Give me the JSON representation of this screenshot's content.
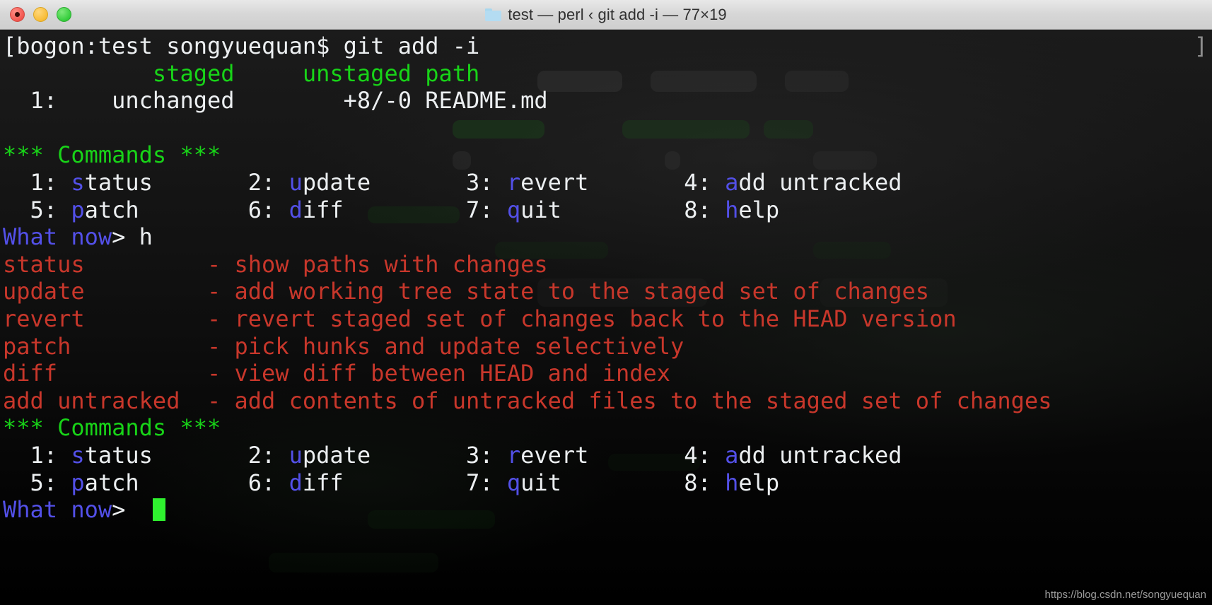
{
  "window": {
    "title": "test — perl ‹ git add -i — 77×19",
    "folder_icon": "folder-icon",
    "buttons": {
      "close": "close-button",
      "minimize": "minimize-button",
      "maximize": "maximize-button"
    }
  },
  "colors": {
    "background": "#0d0d0d",
    "foreground": "#eceff1",
    "green": "#18d318",
    "blue": "#5350e8",
    "red": "#c8372b",
    "cursor": "#2ff22f",
    "titlebar": "#d6d6d6"
  },
  "terminal": {
    "size": "77×19",
    "prompt_bracket_right": "]",
    "lines": [
      {
        "name": "shell-prompt-line",
        "segments": [
          {
            "text": "[bogon:test songyuequan$ git add -i",
            "color": "white"
          }
        ]
      },
      {
        "name": "status-header-line",
        "segments": [
          {
            "text": "           ",
            "color": "white"
          },
          {
            "text": "staged",
            "color": "green"
          },
          {
            "text": "     ",
            "color": "white"
          },
          {
            "text": "unstaged path",
            "color": "green"
          }
        ]
      },
      {
        "name": "status-row-readme",
        "segments": [
          {
            "text": "  1:    unchanged        +8/-0 README.md",
            "color": "white"
          }
        ]
      },
      {
        "name": "blank-line-1",
        "segments": [
          {
            "text": " ",
            "color": "white"
          }
        ]
      },
      {
        "name": "commands-heading-1",
        "segments": [
          {
            "text": "*** Commands ***",
            "color": "green"
          }
        ]
      },
      {
        "name": "commands-row-1a",
        "segments": [
          {
            "text": "  1: ",
            "color": "white"
          },
          {
            "text": "s",
            "color": "blue"
          },
          {
            "text": "tatus       ",
            "color": "white"
          },
          {
            "text": "2: ",
            "color": "white"
          },
          {
            "text": "u",
            "color": "blue"
          },
          {
            "text": "pdate       ",
            "color": "white"
          },
          {
            "text": "3: ",
            "color": "white"
          },
          {
            "text": "r",
            "color": "blue"
          },
          {
            "text": "evert       ",
            "color": "white"
          },
          {
            "text": "4: ",
            "color": "white"
          },
          {
            "text": "a",
            "color": "blue"
          },
          {
            "text": "dd untracked",
            "color": "white"
          }
        ]
      },
      {
        "name": "commands-row-1b",
        "segments": [
          {
            "text": "  5: ",
            "color": "white"
          },
          {
            "text": "p",
            "color": "blue"
          },
          {
            "text": "atch        ",
            "color": "white"
          },
          {
            "text": "6: ",
            "color": "white"
          },
          {
            "text": "d",
            "color": "blue"
          },
          {
            "text": "iff         ",
            "color": "white"
          },
          {
            "text": "7: ",
            "color": "white"
          },
          {
            "text": "q",
            "color": "blue"
          },
          {
            "text": "uit         ",
            "color": "white"
          },
          {
            "text": "8: ",
            "color": "white"
          },
          {
            "text": "h",
            "color": "blue"
          },
          {
            "text": "elp",
            "color": "white"
          }
        ]
      },
      {
        "name": "what-now-prompt-1",
        "segments": [
          {
            "text": "What now",
            "color": "blue"
          },
          {
            "text": "> h",
            "color": "white"
          }
        ]
      },
      {
        "name": "help-line-status",
        "segments": [
          {
            "text": "status         - show paths with changes",
            "color": "red"
          }
        ]
      },
      {
        "name": "help-line-update",
        "segments": [
          {
            "text": "update         - add working tree state to the staged set of changes",
            "color": "red"
          }
        ]
      },
      {
        "name": "help-line-revert",
        "segments": [
          {
            "text": "revert         - revert staged set of changes back to the HEAD version",
            "color": "red"
          }
        ]
      },
      {
        "name": "help-line-patch",
        "segments": [
          {
            "text": "patch          - pick hunks and update selectively",
            "color": "red"
          }
        ]
      },
      {
        "name": "help-line-diff",
        "segments": [
          {
            "text": "diff           - view diff between HEAD and index",
            "color": "red"
          }
        ]
      },
      {
        "name": "help-line-add-untracked",
        "segments": [
          {
            "text": "add untracked  - add contents of untracked files to the staged set of changes",
            "color": "red"
          }
        ]
      },
      {
        "name": "commands-heading-2",
        "segments": [
          {
            "text": "*** Commands ***",
            "color": "green"
          }
        ]
      },
      {
        "name": "commands-row-2a",
        "segments": [
          {
            "text": "  1: ",
            "color": "white"
          },
          {
            "text": "s",
            "color": "blue"
          },
          {
            "text": "tatus       ",
            "color": "white"
          },
          {
            "text": "2: ",
            "color": "white"
          },
          {
            "text": "u",
            "color": "blue"
          },
          {
            "text": "pdate       ",
            "color": "white"
          },
          {
            "text": "3: ",
            "color": "white"
          },
          {
            "text": "r",
            "color": "blue"
          },
          {
            "text": "evert       ",
            "color": "white"
          },
          {
            "text": "4: ",
            "color": "white"
          },
          {
            "text": "a",
            "color": "blue"
          },
          {
            "text": "dd untracked",
            "color": "white"
          }
        ]
      },
      {
        "name": "commands-row-2b",
        "segments": [
          {
            "text": "  5: ",
            "color": "white"
          },
          {
            "text": "p",
            "color": "blue"
          },
          {
            "text": "atch        ",
            "color": "white"
          },
          {
            "text": "6: ",
            "color": "white"
          },
          {
            "text": "d",
            "color": "blue"
          },
          {
            "text": "iff         ",
            "color": "white"
          },
          {
            "text": "7: ",
            "color": "white"
          },
          {
            "text": "q",
            "color": "blue"
          },
          {
            "text": "uit         ",
            "color": "white"
          },
          {
            "text": "8: ",
            "color": "white"
          },
          {
            "text": "h",
            "color": "blue"
          },
          {
            "text": "elp",
            "color": "white"
          }
        ]
      },
      {
        "name": "what-now-prompt-2",
        "segments": [
          {
            "text": "What now",
            "color": "blue"
          },
          {
            "text": ">  ",
            "color": "white"
          }
        ],
        "cursor": true
      }
    ]
  },
  "watermark": "https://blog.csdn.net/songyuequan"
}
